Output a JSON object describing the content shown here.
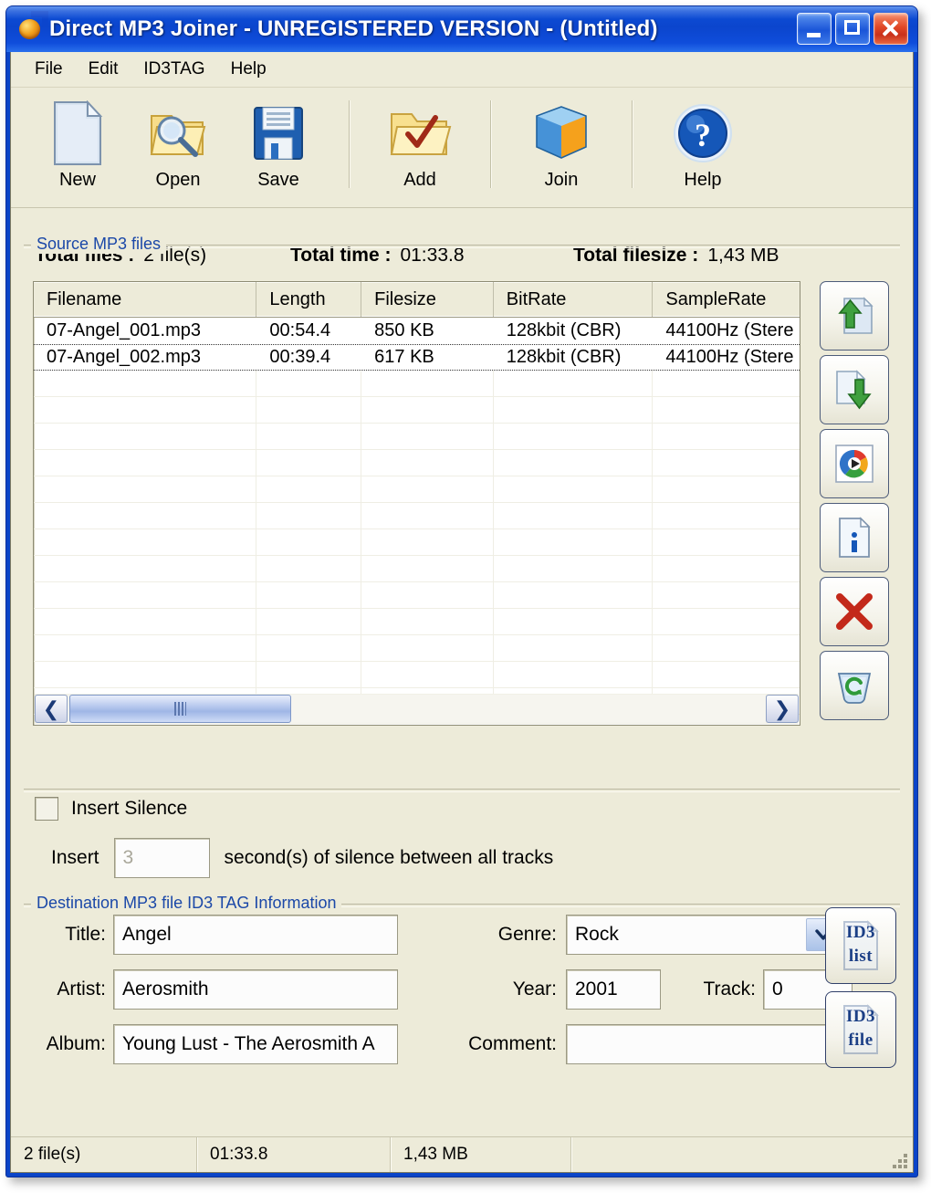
{
  "window": {
    "title": "Direct MP3 Joiner  -  UNREGISTERED VERSION  -  (Untitled)",
    "icon": "mp3-disc-icon",
    "minimize_label": "Minimize",
    "maximize_label": "Maximize",
    "close_label": "Close"
  },
  "menubar": {
    "items": [
      {
        "label": "File"
      },
      {
        "label": "Edit"
      },
      {
        "label": "ID3TAG"
      },
      {
        "label": "Help"
      }
    ]
  },
  "toolbar": {
    "buttons": [
      {
        "label": "New",
        "icon": "new-document-icon"
      },
      {
        "label": "Open",
        "icon": "open-folder-magnifier-icon"
      },
      {
        "label": "Save",
        "icon": "floppy-disk-icon"
      },
      {
        "label": "Add",
        "icon": "folder-checkmark-icon"
      },
      {
        "label": "Join",
        "icon": "blue-orange-cube-icon"
      },
      {
        "label": "Help",
        "icon": "blue-question-icon"
      }
    ]
  },
  "source_group": {
    "title": "Source MP3 files",
    "totals": [
      {
        "key": "Total files :",
        "value": "2 file(s)"
      },
      {
        "key": "Total time :",
        "value": "01:33.8"
      },
      {
        "key": "Total filesize :",
        "value": "1,43 MB"
      }
    ],
    "columns": [
      "Filename",
      "Length",
      "Filesize",
      "BitRate",
      "SampleRate"
    ],
    "rows": [
      {
        "filename": "07-Angel_001.mp3",
        "length": "00:54.4",
        "filesize": "850 KB",
        "bitrate": "128kbit (CBR)",
        "samplerate": "44100Hz (Stere"
      },
      {
        "filename": "07-Angel_002.mp3",
        "length": "00:39.4",
        "filesize": "617 KB",
        "bitrate": "128kbit (CBR)",
        "samplerate": "44100Hz (Stere"
      }
    ],
    "scrollbar": {
      "left_arrow": "❮",
      "right_arrow": "❯"
    },
    "side_buttons": [
      {
        "name": "move-up-button",
        "icon": "file-up-arrow-icon"
      },
      {
        "name": "move-down-button",
        "icon": "file-down-arrow-icon"
      },
      {
        "name": "play-button",
        "icon": "media-player-icon"
      },
      {
        "name": "file-info-button",
        "icon": "file-info-icon"
      },
      {
        "name": "remove-button",
        "icon": "red-x-icon"
      },
      {
        "name": "clear-list-button",
        "icon": "recycle-refresh-icon"
      }
    ]
  },
  "silence": {
    "checkbox_label": "Insert Silence",
    "checked": false,
    "prefix": "Insert",
    "value": "3",
    "suffix": "second(s) of silence between all tracks"
  },
  "id3_group": {
    "title": "Destination MP3 file ID3 TAG Information",
    "fields": {
      "title": {
        "label": "Title:",
        "value": "Angel"
      },
      "artist": {
        "label": "Artist:",
        "value": "Aerosmith"
      },
      "album": {
        "label": "Album:",
        "value": "Young Lust - The Aerosmith A"
      },
      "genre": {
        "label": "Genre:",
        "value": "Rock"
      },
      "year": {
        "label": "Year:",
        "value": "2001"
      },
      "track": {
        "label": "Track:",
        "value": "0"
      },
      "comment": {
        "label": "Comment:",
        "value": ""
      }
    },
    "buttons": [
      {
        "line1": "ID3",
        "line2": "list",
        "icon": "id3-list-icon"
      },
      {
        "line1": "ID3",
        "line2": "file",
        "icon": "id3-file-icon"
      }
    ]
  },
  "statusbar": {
    "cells": [
      "2 file(s)",
      "01:33.8",
      "1,43 MB",
      ""
    ]
  },
  "colors": {
    "titlebar_blue": "#0b45cd",
    "window_background": "#edebd9",
    "group_label_blue": "#1b48a8",
    "close_red": "#e04726"
  }
}
